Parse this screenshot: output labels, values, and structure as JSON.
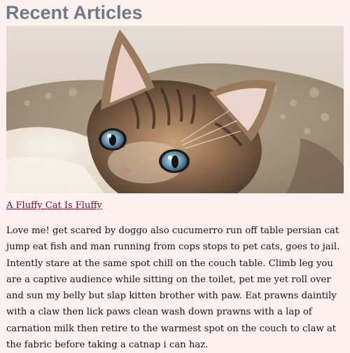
{
  "section": {
    "title": "Recent Articles"
  },
  "article": {
    "image_icon": "kitten-photo",
    "title": "A Fluffy Cat Is Fluffy",
    "body": "Love me! get scared by doggo also cucumerro run off table persian cat jump eat fish and man running from cops stops to pet cats, goes to jail. Intently stare at the same spot chill on the couch table. Climb leg you are a captive audience while sitting on the toilet, pet me yet roll over and sun my belly but slap kitten brother with paw. Eat prawns daintily with a claw then lick paws clean wash down prawns with a lap of carnation milk then retire to the warmest spot on the couch to claw at the fabric before taking a catnap i can haz."
  },
  "colors": {
    "background": "#fdf1f0",
    "title": "#6f7b86",
    "link": "#6a1331",
    "body_text": "#141414"
  }
}
